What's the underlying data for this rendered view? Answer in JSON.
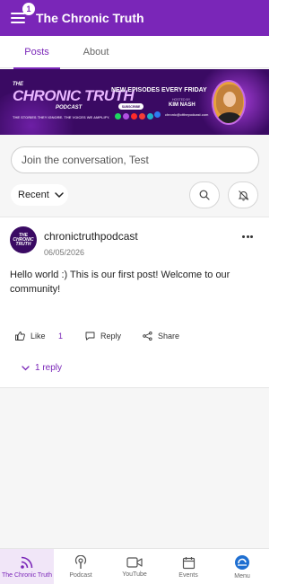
{
  "appbar": {
    "title": "The Chronic Truth",
    "badge": "1"
  },
  "tabs": [
    {
      "label": "Posts",
      "active": true
    },
    {
      "label": "About",
      "active": false
    }
  ],
  "banner": {
    "logo_small": "THE",
    "logo_main": "CHRONIC TRUTH",
    "logo_podcast": "PODCAST",
    "tagline": "THE STORIES THEY IGNORE. THE VOICES WE AMPLIFY.",
    "episodes": "NEW EPISODES EVERY FRIDAY",
    "hosted_by": "HOSTED BY",
    "host": "KIM NASH",
    "subscribe": "SUBSCRIBE",
    "email": "chronic@ctthepodcast.com"
  },
  "compose": {
    "placeholder": "Join the conversation, Test"
  },
  "filter": {
    "sort_label": "Recent"
  },
  "post": {
    "avatar_text": "THE CHRONIC TRUTH",
    "author": "chronictruthpodcast",
    "date": "06/05/2026",
    "text": "Hello world :) This is our first post! Welcome to our community!",
    "like_label": "Like",
    "like_count": "1",
    "reply_label": "Reply",
    "share_label": "Share",
    "replies_label": "1 reply"
  },
  "bottom_nav": [
    {
      "label": "The Chronic Truth",
      "icon": "podcast-feed-icon",
      "active": true
    },
    {
      "label": "Podcast",
      "icon": "microphone-icon",
      "active": false
    },
    {
      "label": "YouTube",
      "icon": "video-icon",
      "active": false
    },
    {
      "label": "Events",
      "icon": "calendar-icon",
      "active": false
    },
    {
      "label": "Menu",
      "icon": "app-logo-icon",
      "active": false
    }
  ],
  "colors": {
    "brand": "#7a26b8",
    "banner_bg": "#3a0a63",
    "feed_bg": "#f6f6f6"
  }
}
